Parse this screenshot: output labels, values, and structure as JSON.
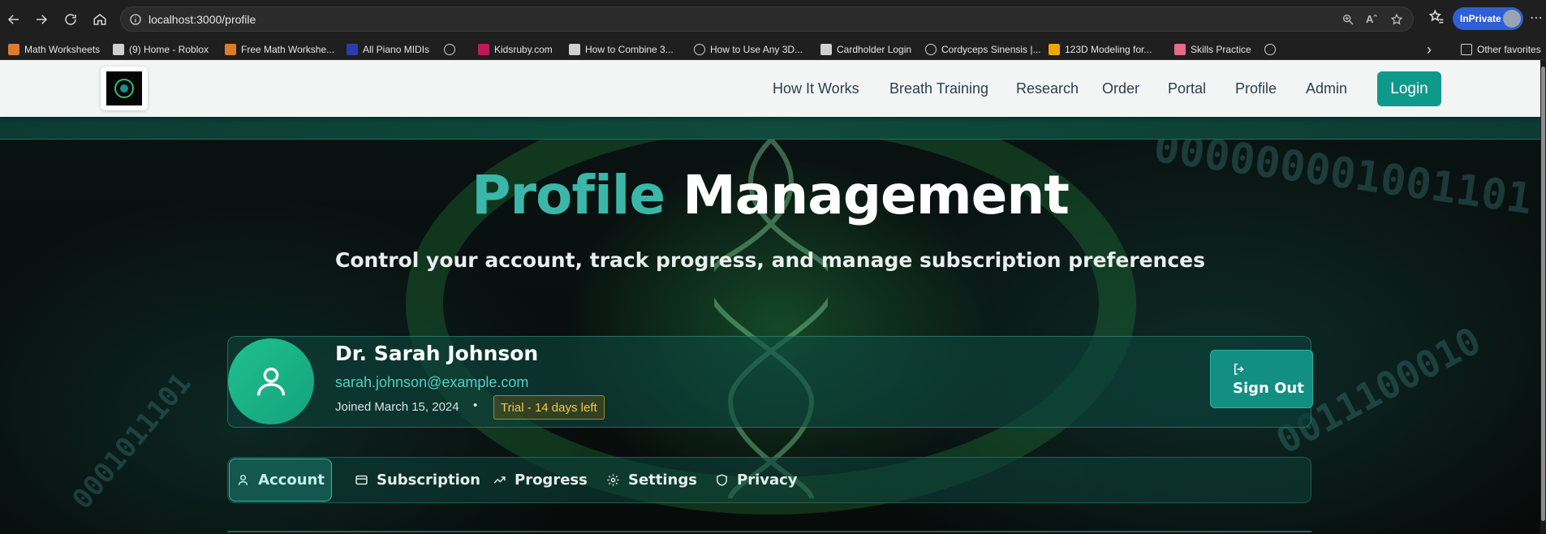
{
  "browser": {
    "url": "localhost:3000/profile",
    "inprivate_label": "InPrivate",
    "bookmarks": [
      {
        "label": "Math Worksheets",
        "color": "#e07b2a"
      },
      {
        "label": "(9) Home - Roblox",
        "color": "#d0d0d0"
      },
      {
        "label": "Free Math Workshe...",
        "color": "#e07b2a"
      },
      {
        "label": "All Piano MIDIs",
        "color": "#2a3bb8"
      },
      {
        "label": "",
        "color": "globe"
      },
      {
        "label": "Kidsruby.com",
        "color": "#c2185b"
      },
      {
        "label": "How to Combine 3...",
        "color": "#d0d0d0"
      },
      {
        "label": "How to Use Any 3D...",
        "color": "globe"
      },
      {
        "label": "Cardholder Login",
        "color": "#d0d0d0"
      },
      {
        "label": "Cordyceps Sinensis |...",
        "color": "globe"
      },
      {
        "label": "123D Modeling for...",
        "color": "#f0a500"
      },
      {
        "label": "Skills Practice",
        "color": "#e86a8a"
      },
      {
        "label": "",
        "color": "globe"
      }
    ],
    "other_favorites": "Other favorites"
  },
  "header": {
    "nav": [
      "How It Works",
      "Breath Training",
      "Research",
      "Order",
      "Portal",
      "Profile",
      "Admin"
    ],
    "login": "Login"
  },
  "hero": {
    "title_accent": "Profile",
    "title_rest": "Management",
    "subtitle": "Control your account, track progress, and manage subscription preferences"
  },
  "profile": {
    "name": "Dr. Sarah Johnson",
    "email": "sarah.johnson@example.com",
    "joined": "Joined March 15, 2024",
    "bullet": "•",
    "trial_badge": "Trial - 14 days left",
    "sign_out": "Sign Out"
  },
  "tabs": [
    {
      "label": "Account",
      "icon": "user-icon",
      "active": true
    },
    {
      "label": "Subscription",
      "icon": "credit-card-icon",
      "active": false
    },
    {
      "label": "Progress",
      "icon": "trending-up-icon",
      "active": false
    },
    {
      "label": "Settings",
      "icon": "gear-icon",
      "active": false
    },
    {
      "label": "Privacy",
      "icon": "shield-icon",
      "active": false
    }
  ],
  "colors": {
    "accent": "#3ab7a8",
    "primary_button": "#0e9a8a",
    "trial_badge_text": "#f2c94c"
  }
}
